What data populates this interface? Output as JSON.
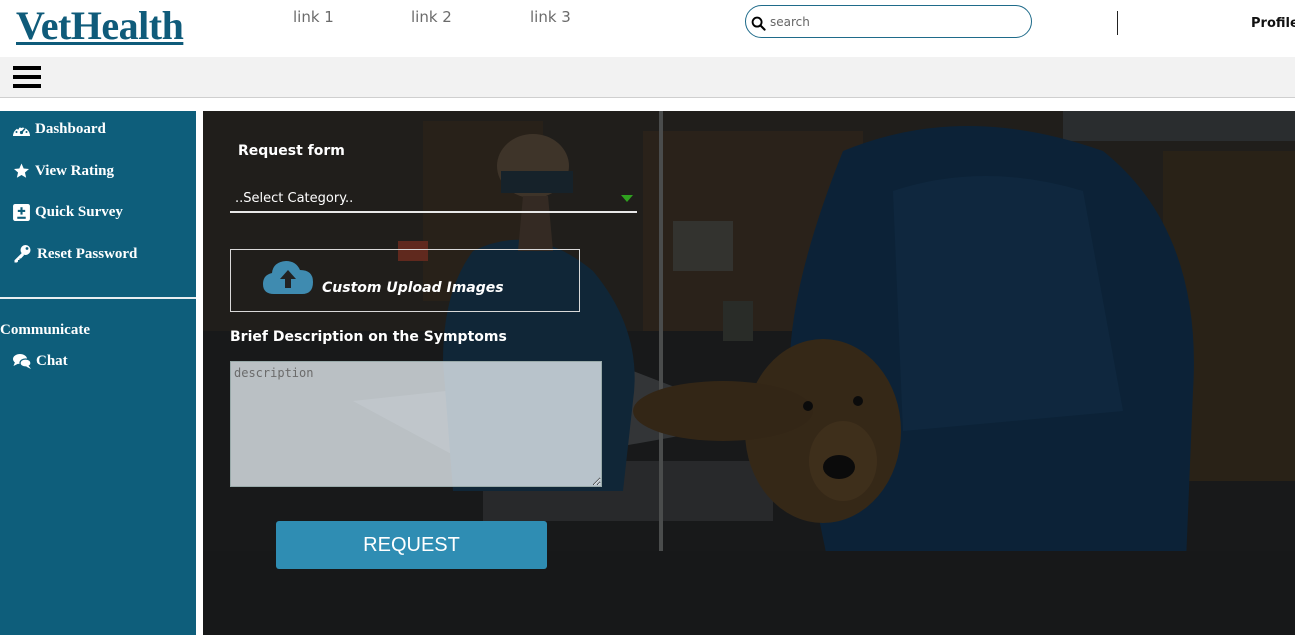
{
  "brand": {
    "name": "VetHealth",
    "color": "#0f5b7a"
  },
  "nav": {
    "links": [
      "link 1",
      "link 2",
      "link 3"
    ],
    "search_placeholder": "search",
    "profile_label": "Profile"
  },
  "sidebar": {
    "items": [
      {
        "label": "Dashboard",
        "icon": "dashboard-icon"
      },
      {
        "label": "View Rating",
        "icon": "star-icon"
      },
      {
        "label": "Quick Survey",
        "icon": "survey-icon"
      },
      {
        "label": "Reset Password",
        "icon": "key-icon"
      }
    ],
    "section_heading": "Communicate",
    "section_items": [
      {
        "label": "Chat",
        "icon": "chat-icon"
      }
    ],
    "background": "#0e5e7b"
  },
  "form": {
    "title": "Request form",
    "category_selected": "..Select Category..",
    "upload_label": "Custom Upload Images",
    "description_label": "Brief Description on the Symptoms",
    "description_placeholder": "description",
    "submit_label": "REQUEST",
    "accent": "#2f8db3"
  },
  "background_image": "veterinarians-examining-golden-retriever-photo"
}
